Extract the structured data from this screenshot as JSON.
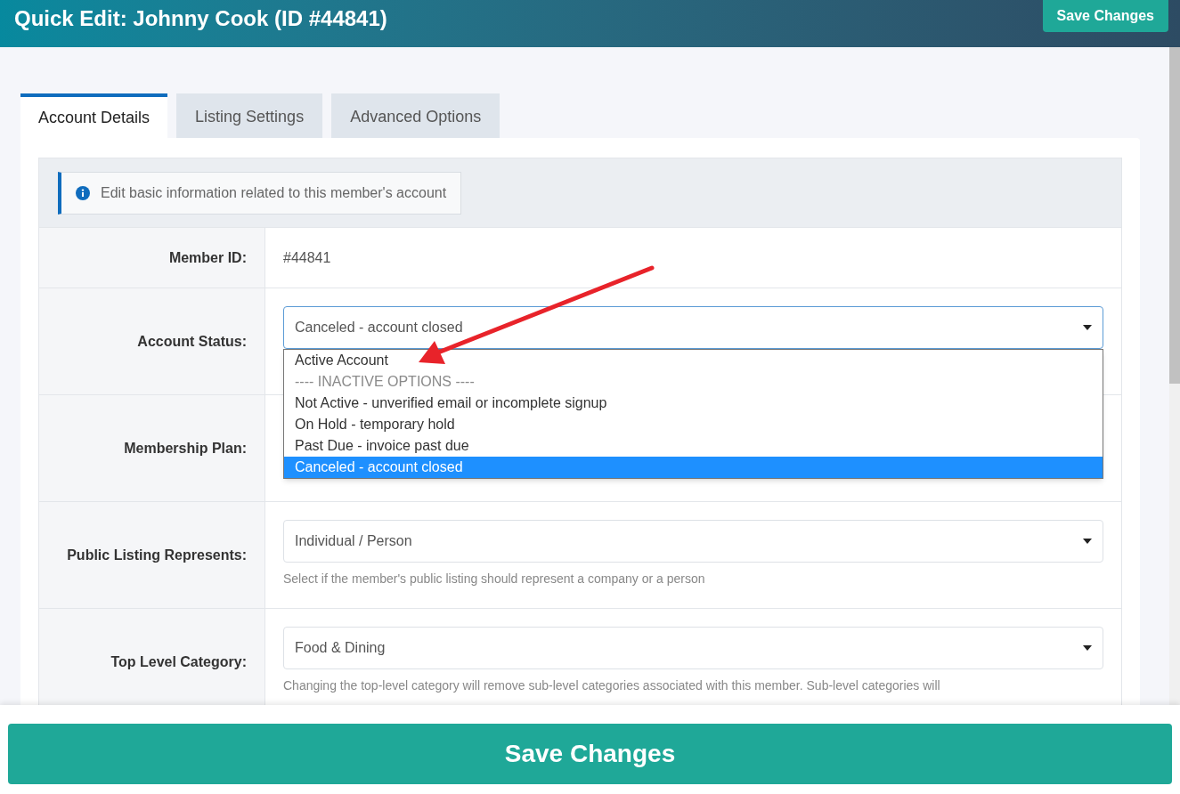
{
  "header": {
    "title": "Quick Edit: Johnny Cook (ID #44841)",
    "save_button": "Save Changes"
  },
  "tabs": [
    {
      "label": "Account Details",
      "selected": true
    },
    {
      "label": "Listing Settings",
      "selected": false
    },
    {
      "label": "Advanced Options",
      "selected": false
    }
  ],
  "info_note": "Edit basic information related to this member's account",
  "fields": [
    {
      "label": "Member ID:",
      "kind": "text",
      "value": "#44841"
    },
    {
      "label": "Account Status:",
      "kind": "select",
      "value": "Canceled - account closed",
      "expanded": true,
      "options": [
        {
          "label": "Active Account",
          "disabled": false,
          "selected": false
        },
        {
          "label": "---- INACTIVE OPTIONS ----",
          "disabled": true,
          "selected": false
        },
        {
          "label": "Not Active - unverified email or incomplete signup",
          "disabled": false,
          "selected": false
        },
        {
          "label": "On Hold - temporary hold",
          "disabled": false,
          "selected": false
        },
        {
          "label": "Past Due - invoice past due",
          "disabled": false,
          "selected": false
        },
        {
          "label": "Canceled - account closed",
          "disabled": false,
          "selected": true
        }
      ]
    },
    {
      "label": "Membership Plan:",
      "kind": "covered"
    },
    {
      "label": "Public Listing Represents:",
      "kind": "select",
      "value": "Individual / Person",
      "expanded": false,
      "help": "Select if the member's public listing should represent a company or a person"
    },
    {
      "label": "Top Level Category:",
      "kind": "select",
      "value": "Food & Dining",
      "expanded": false,
      "help": "Changing the top-level category will remove sub-level categories associated with this member. Sub-level categories will"
    }
  ],
  "footer_button": "Save Changes"
}
